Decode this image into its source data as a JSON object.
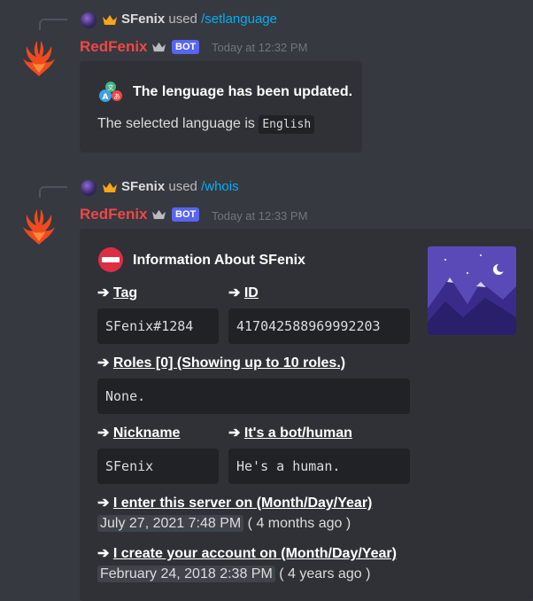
{
  "messages": [
    {
      "reply": {
        "user": "SFenix",
        "used_text": "used",
        "command": "/setlanguage"
      },
      "author": "RedFenix",
      "badge": "BOT",
      "timestamp": "Today at 12:32 PM",
      "embed": {
        "title": "The lenguage has been updated.",
        "text_prefix": "The selected language is",
        "language": "English"
      }
    },
    {
      "reply": {
        "user": "SFenix",
        "used_text": "used",
        "command": "/whois"
      },
      "author": "RedFenix",
      "badge": "BOT",
      "timestamp": "Today at 12:33 PM",
      "embed": {
        "title": "Information About SFenix",
        "fields": {
          "tag": {
            "arrow": "➔",
            "name": "Tag",
            "value": "SFenix#1284"
          },
          "id": {
            "arrow": "➔",
            "name": "ID",
            "value": "417042588969992203"
          },
          "roles": {
            "arrow": "➔",
            "name": "Roles [0] (Showing up to 10 roles.)",
            "value": "None."
          },
          "nickname": {
            "arrow": "➔",
            "name": "Nickname",
            "value": "SFenix"
          },
          "bot_human": {
            "arrow": "➔",
            "name": "It's a bot/human",
            "value": "He's a human."
          },
          "joined": {
            "arrow": "➔",
            "name": "I enter this server on (Month/Day/Year)",
            "date": "July 27, 2021 7:48 PM",
            "relative": "( 4 months ago )"
          },
          "created": {
            "arrow": "➔",
            "name": "I create your account on (Month/Day/Year)",
            "date": "February 24, 2018 2:38 PM",
            "relative": "( 4 years ago )"
          }
        }
      }
    }
  ],
  "colors": {
    "background": "#36393f",
    "embed": "#2f3136",
    "codeblock": "#202225",
    "bot_name": "#f04747",
    "command_link": "#00aff4",
    "badge": "#5865f2",
    "crown": "#faa61a"
  },
  "icons": [
    "phoenix-avatar-icon",
    "crown-icon",
    "translate-icon",
    "no-entry-icon",
    "reply-avatar-icon"
  ]
}
